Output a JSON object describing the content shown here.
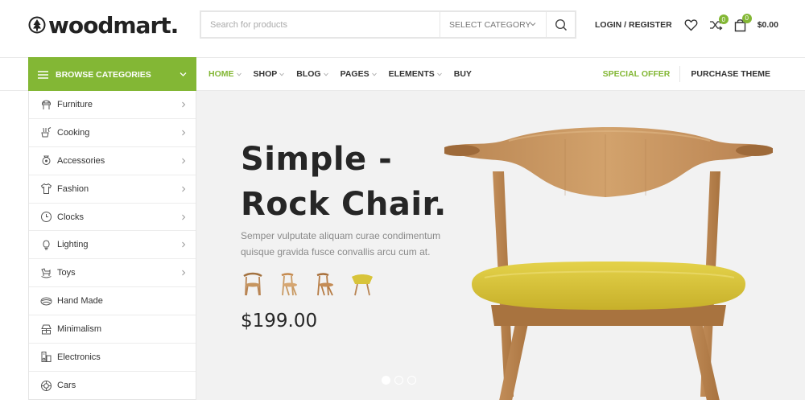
{
  "header": {
    "logo_text": "woodmart.",
    "search_placeholder": "Search for products",
    "category_select": "Select category",
    "login_label": "Login / Register",
    "wishlist_icon": "heart-icon",
    "compare_icon": "shuffle-icon",
    "compare_count": "0",
    "cart_icon": "shopping-bag-icon",
    "cart_count": "0",
    "cart_total": "$0.00"
  },
  "nav": {
    "browse_label": "Browse Categories",
    "items": [
      {
        "label": "Home",
        "active": true,
        "dropdown": true
      },
      {
        "label": "Shop",
        "active": false,
        "dropdown": true
      },
      {
        "label": "Blog",
        "active": false,
        "dropdown": true
      },
      {
        "label": "Pages",
        "active": false,
        "dropdown": true
      },
      {
        "label": "Elements",
        "active": false,
        "dropdown": true
      },
      {
        "label": "Buy",
        "active": false,
        "dropdown": false
      }
    ],
    "special_offer": "Special Offer",
    "purchase_theme": "Purchase Theme"
  },
  "categories": [
    {
      "label": "Furniture",
      "icon": "chair-icon",
      "submenu": true
    },
    {
      "label": "Cooking",
      "icon": "cooking-icon",
      "submenu": true
    },
    {
      "label": "Accessories",
      "icon": "accessories-icon",
      "submenu": true
    },
    {
      "label": "Fashion",
      "icon": "shirt-icon",
      "submenu": true
    },
    {
      "label": "Clocks",
      "icon": "clock-icon",
      "submenu": true
    },
    {
      "label": "Lighting",
      "icon": "bulb-icon",
      "submenu": true
    },
    {
      "label": "Toys",
      "icon": "toy-horse-icon",
      "submenu": true
    },
    {
      "label": "Hand Made",
      "icon": "yarn-icon",
      "submenu": false
    },
    {
      "label": "Minimalism",
      "icon": "lamp-icon",
      "submenu": false
    },
    {
      "label": "Electronics",
      "icon": "electronics-icon",
      "submenu": false
    },
    {
      "label": "Cars",
      "icon": "wheel-icon",
      "submenu": false
    }
  ],
  "hero": {
    "title_line1": "Simple -",
    "title_line2": "Rock Chair.",
    "description": "Semper vulputate aliquam curae condimentum quisque gravida fusce convallis arcu cum at.",
    "price": "$199.00",
    "slides": 3,
    "active_slide": 1
  },
  "colors": {
    "accent": "#83b735",
    "text": "#333333",
    "hero_bg": "#f2f2f2",
    "chair_wood": "#c99a63",
    "chair_seat": "#d8c43a"
  }
}
